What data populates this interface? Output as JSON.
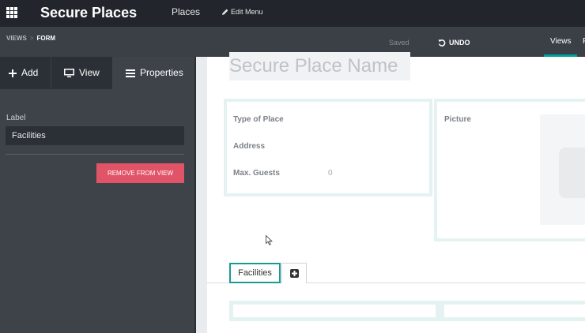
{
  "topbar": {
    "app_title": "Secure Places",
    "menu_places": "Places",
    "menu_edit": "Edit Menu"
  },
  "subbar": {
    "breadcrumb_views": "VIEWS",
    "breadcrumb_sep": ">",
    "breadcrumb_form": "FORM",
    "saved": "Saved",
    "undo": "UNDO",
    "views_tab": "Views",
    "next_tab_fragment": "F"
  },
  "sidebar": {
    "tabs": [
      {
        "label": "Add",
        "icon": "plus-icon"
      },
      {
        "label": "View",
        "icon": "monitor-icon"
      },
      {
        "label": "Properties",
        "icon": "list-icon"
      }
    ],
    "label_title": "Label",
    "label_value": "Facilities",
    "remove_button": "REMOVE FROM VIEW"
  },
  "form": {
    "name_placeholder": "Secure Place Name",
    "fields": {
      "type_of_place": "Type of Place",
      "address": "Address",
      "max_guests": "Max. Guests",
      "max_guests_value": "0",
      "picture": "Picture"
    },
    "tabs": {
      "facilities": "Facilities"
    }
  },
  "colors": {
    "accent": "#00a09d",
    "danger": "#e15468",
    "topbar": "#22262c",
    "sidebar": "#3e434a"
  }
}
